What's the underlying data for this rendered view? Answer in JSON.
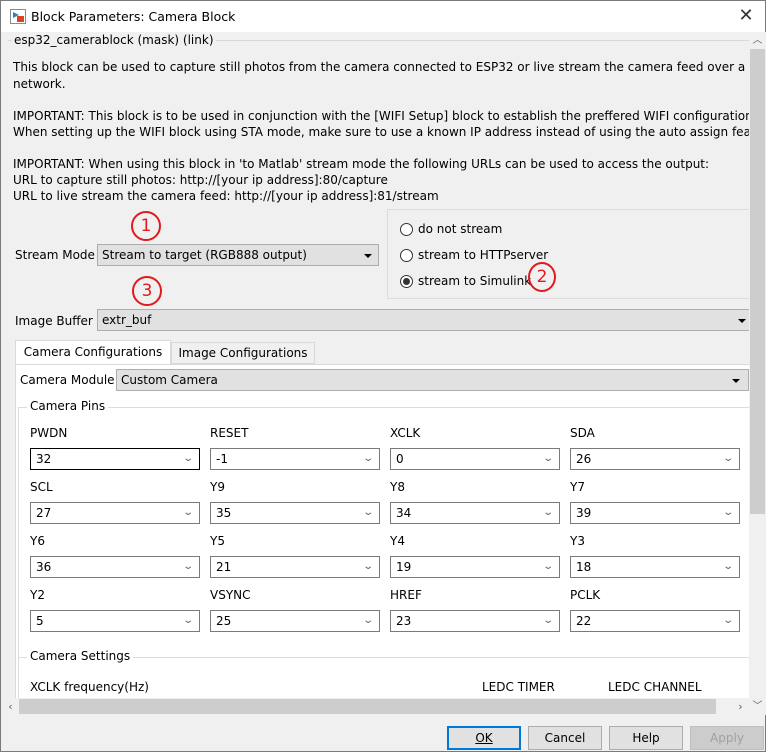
{
  "window": {
    "title": "Block Parameters: Camera Block",
    "close_icon": "close-icon"
  },
  "mask": {
    "legend": "esp32_camerablock (mask) (link)",
    "description": [
      "This block can be used to capture still photos from the camera connected to ESP32 or live stream the camera feed over a TCP/IP",
      "network.",
      "IMPORTANT: This block is to be used in conjunction with the [WIFI Setup] block to establish the preffered WIFI configuration.",
      "When setting up the WIFI block using STA mode, make sure to use a known IP address instead of using the auto assign feature",
      "IMPORTANT: When using this block in 'to Matlab' stream mode the following URLs can be used to access the output:",
      "URL to capture still photos: http://[your ip address]:80/capture",
      "URL to live stream the camera feed: http://[your ip address]:81/stream"
    ]
  },
  "stream_mode": {
    "label": "Stream Mode",
    "value": "Stream to target (RGB888 output)"
  },
  "stream_options": [
    {
      "label": "do not stream",
      "checked": false
    },
    {
      "label": "stream to HTTPserver",
      "checked": false
    },
    {
      "label": "stream to Simulink",
      "checked": true
    }
  ],
  "image_buffer": {
    "label": "Image Buffer",
    "value": "extr_buf"
  },
  "annotations": [
    "1",
    "2",
    "3"
  ],
  "tabs": [
    {
      "label": "Camera Configurations",
      "active": true
    },
    {
      "label": "Image Configurations",
      "active": false
    }
  ],
  "camera_module": {
    "label": "Camera Module",
    "value": "Custom Camera"
  },
  "camera_pins": {
    "legend": "Camera Pins",
    "pins": [
      {
        "label": "PWDN",
        "value": "32"
      },
      {
        "label": "RESET",
        "value": "-1"
      },
      {
        "label": "XCLK",
        "value": "0"
      },
      {
        "label": "SDA",
        "value": "26"
      },
      {
        "label": "SCL",
        "value": "27"
      },
      {
        "label": "Y9",
        "value": "35"
      },
      {
        "label": "Y8",
        "value": "34"
      },
      {
        "label": "Y7",
        "value": "39"
      },
      {
        "label": "Y6",
        "value": "36"
      },
      {
        "label": "Y5",
        "value": "21"
      },
      {
        "label": "Y4",
        "value": "19"
      },
      {
        "label": "Y3",
        "value": "18"
      },
      {
        "label": "Y2",
        "value": "5"
      },
      {
        "label": "VSYNC",
        "value": "25"
      },
      {
        "label": "HREF",
        "value": "23"
      },
      {
        "label": "PCLK",
        "value": "22"
      }
    ]
  },
  "camera_settings": {
    "legend": "Camera Settings",
    "xclk_label": "XCLK frequency(Hz)",
    "ledc_timer_label": "LEDC TIMER",
    "ledc_channel_label": "LEDC CHANNEL"
  },
  "buttons": {
    "ok": "OK",
    "cancel": "Cancel",
    "help": "Help",
    "apply": "Apply"
  }
}
